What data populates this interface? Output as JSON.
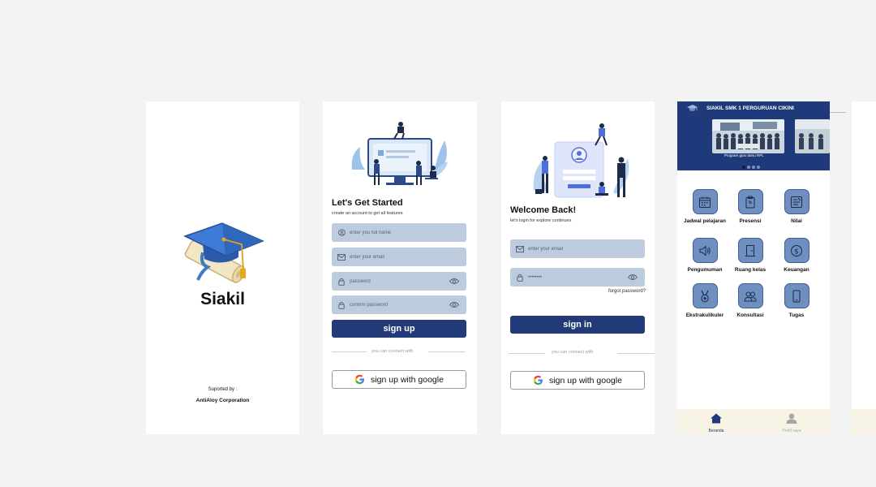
{
  "splash": {
    "title": "Siakil",
    "supported_by": "Suported by :",
    "corporation": "AntiAloy Corporation"
  },
  "signup": {
    "title": "Let's Get Started",
    "subtitle": "create an account to get all features",
    "fields": {
      "fullname_placeholder": "enter you full name",
      "email_placeholder": "enter your email",
      "password_placeholder": "password",
      "confirm_placeholder": "confirm password"
    },
    "submit_label": "sign up",
    "divider_text": "you can connect with",
    "google_label": "sign up with google"
  },
  "login": {
    "title": "Welcome Back!",
    "subtitle": "let's login for explore continues",
    "fields": {
      "email_placeholder": "enter your email",
      "password_value": "••••••••"
    },
    "forgot_label": "forgot password?",
    "submit_label": "sign in",
    "divider_text": "you can connect with",
    "google_label": "sign up with google"
  },
  "dashboard": {
    "title": "SIAKIL SMK 1 PERGURUAN CIKINI",
    "banner_caption": "Program guru tamu RPL",
    "menu": [
      {
        "label": "Jadwal pelajaran",
        "icon": "calendar-icon"
      },
      {
        "label": "Presensi",
        "icon": "clipboard-icon"
      },
      {
        "label": "Nilai",
        "icon": "report-icon"
      },
      {
        "label": "Pengumuman",
        "icon": "speaker-icon"
      },
      {
        "label": "Ruang kelas",
        "icon": "door-icon"
      },
      {
        "label": "Keuangan",
        "icon": "dollar-icon"
      },
      {
        "label": "Ekstrakulikuler",
        "icon": "medal-icon"
      },
      {
        "label": "Konsultasi",
        "icon": "people-icon"
      },
      {
        "label": "Tugas",
        "icon": "phone-icon"
      }
    ],
    "nav": {
      "home_label": "Beranda",
      "profile_label": "Profil saya"
    }
  },
  "colors": {
    "primary": "#223a77",
    "field_bg": "#bccbde",
    "menu_icon_bg": "#6e8fbf",
    "bottom_nav_bg": "#f7f3e5",
    "page_bg": "#f3f3f3"
  }
}
